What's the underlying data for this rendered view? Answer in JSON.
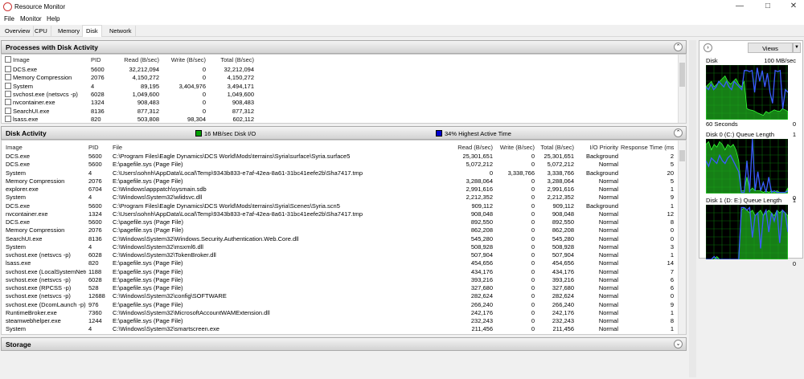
{
  "window": {
    "title": "Resource Monitor"
  },
  "menu": [
    "File",
    "Monitor",
    "Help"
  ],
  "tabs": [
    "Overview",
    "CPU",
    "Memory",
    "Disk",
    "Network"
  ],
  "active_tab": "Disk",
  "processes": {
    "title": "Processes with Disk Activity",
    "columns": [
      "Image",
      "PID",
      "Read (B/sec)",
      "Write (B/sec)",
      "Total (B/sec)"
    ],
    "rows": [
      [
        "DCS.exe",
        "5600",
        "32,212,094",
        "0",
        "32,212,094"
      ],
      [
        "Memory Compression",
        "2076",
        "4,150,272",
        "0",
        "4,150,272"
      ],
      [
        "System",
        "4",
        "89,195",
        "3,404,976",
        "3,494,171"
      ],
      [
        "svchost.exe (netsvcs -p)",
        "6028",
        "1,049,600",
        "0",
        "1,049,600"
      ],
      [
        "nvcontainer.exe",
        "1324",
        "908,483",
        "0",
        "908,483"
      ],
      [
        "SearchUI.exe",
        "8136",
        "877,312",
        "0",
        "877,312"
      ],
      [
        "lsass.exe",
        "820",
        "503,808",
        "98,304",
        "602,112"
      ]
    ]
  },
  "disk_activity": {
    "title": "Disk Activity",
    "io_label": "16 MB/sec Disk I/O",
    "active_label": "34% Highest Active Time",
    "io_color": "#00a000",
    "active_color": "#0000d0",
    "columns": [
      "Image",
      "PID",
      "File",
      "Read (B/sec)",
      "Write (B/sec)",
      "Total (B/sec)",
      "I/O Priority",
      "Response Time (ms)"
    ],
    "rows": [
      [
        "DCS.exe",
        "5600",
        "C:\\Program Files\\Eagle Dynamics\\DCS World\\Mods\\terrains\\Syria\\surface\\Syria.surface5",
        "25,301,651",
        "0",
        "25,301,651",
        "Background",
        "2"
      ],
      [
        "DCS.exe",
        "5600",
        "E:\\pagefile.sys (Page File)",
        "5,072,212",
        "0",
        "5,072,212",
        "Normal",
        "5"
      ],
      [
        "System",
        "4",
        "C:\\Users\\sohnh\\AppData\\Local\\Temp\\9343b833-e7af-42ea-8a61-31bc41eefe2b\\Sha7417.tmp",
        "0",
        "3,338,766",
        "3,338,766",
        "Background",
        "20"
      ],
      [
        "Memory Compression",
        "2076",
        "E:\\pagefile.sys (Page File)",
        "3,288,064",
        "0",
        "3,288,064",
        "Normal",
        "5"
      ],
      [
        "explorer.exe",
        "6704",
        "C:\\Windows\\apppatch\\sysmain.sdb",
        "2,991,616",
        "0",
        "2,991,616",
        "Normal",
        "1"
      ],
      [
        "System",
        "4",
        "C:\\Windows\\System32\\wlidsvc.dll",
        "2,212,352",
        "0",
        "2,212,352",
        "Normal",
        "9"
      ],
      [
        "DCS.exe",
        "5600",
        "C:\\Program Files\\Eagle Dynamics\\DCS World\\Mods\\terrains\\Syria\\Scenes\\Syria.scn5",
        "909,112",
        "0",
        "909,112",
        "Background",
        "1"
      ],
      [
        "nvcontainer.exe",
        "1324",
        "C:\\Users\\sohnh\\AppData\\Local\\Temp\\9343b833-e7af-42ea-8a61-31bc41eefe2b\\Sha7417.tmp",
        "908,048",
        "0",
        "908,048",
        "Normal",
        "12"
      ],
      [
        "DCS.exe",
        "5600",
        "C:\\pagefile.sys (Page File)",
        "892,550",
        "0",
        "892,550",
        "Normal",
        "8"
      ],
      [
        "Memory Compression",
        "2076",
        "C:\\pagefile.sys (Page File)",
        "862,208",
        "0",
        "862,208",
        "Normal",
        "0"
      ],
      [
        "SearchUI.exe",
        "8136",
        "C:\\Windows\\System32\\Windows.Security.Authentication.Web.Core.dll",
        "545,280",
        "0",
        "545,280",
        "Normal",
        "0"
      ],
      [
        "System",
        "4",
        "C:\\Windows\\System32\\msxml6.dll",
        "508,928",
        "0",
        "508,928",
        "Normal",
        "3"
      ],
      [
        "svchost.exe (netsvcs -p)",
        "6028",
        "C:\\Windows\\System32\\TokenBroker.dll",
        "507,904",
        "0",
        "507,904",
        "Normal",
        "1"
      ],
      [
        "lsass.exe",
        "820",
        "E:\\pagefile.sys (Page File)",
        "454,656",
        "0",
        "454,656",
        "Normal",
        "14"
      ],
      [
        "svchost.exe (LocalSystemNetw...",
        "1188",
        "E:\\pagefile.sys (Page File)",
        "434,176",
        "0",
        "434,176",
        "Normal",
        "7"
      ],
      [
        "svchost.exe (netsvcs -p)",
        "6028",
        "E:\\pagefile.sys (Page File)",
        "393,216",
        "0",
        "393,216",
        "Normal",
        "6"
      ],
      [
        "svchost.exe (RPCSS -p)",
        "528",
        "E:\\pagefile.sys (Page File)",
        "327,680",
        "0",
        "327,680",
        "Normal",
        "6"
      ],
      [
        "svchost.exe (netsvcs -p)",
        "12688",
        "C:\\Windows\\System32\\config\\SOFTWARE",
        "282,624",
        "0",
        "282,624",
        "Normal",
        "0"
      ],
      [
        "svchost.exe (DcomLaunch -p)",
        "976",
        "E:\\pagefile.sys (Page File)",
        "266,240",
        "0",
        "266,240",
        "Normal",
        "9"
      ],
      [
        "RuntimeBroker.exe",
        "7360",
        "C:\\Windows\\System32\\MicrosoftAccountWAMExtension.dll",
        "242,176",
        "0",
        "242,176",
        "Normal",
        "1"
      ],
      [
        "steamwebhelper.exe",
        "1244",
        "E:\\pagefile.sys (Page File)",
        "232,243",
        "0",
        "232,243",
        "Normal",
        "8"
      ],
      [
        "System",
        "4",
        "C:\\Windows\\System32\\smartscreen.exe",
        "211,456",
        "0",
        "211,456",
        "Normal",
        "1"
      ]
    ]
  },
  "storage": {
    "title": "Storage"
  },
  "side": {
    "views_label": "Views",
    "graphs": [
      {
        "title": "Disk",
        "max": "100 MB/sec",
        "min": "0",
        "footer": "60 Seconds",
        "green": [
          0.6,
          0.65,
          0.7,
          0.6,
          0.65,
          0.7,
          0.75,
          0.8,
          0.7,
          0.65,
          0.7,
          0.75,
          0.65,
          0.6,
          0.7,
          0.2,
          0.18,
          0.17,
          0.15,
          0.12,
          0.1,
          0.08,
          0.15,
          0.12,
          0.15,
          0.18,
          0.16,
          0.15,
          0.2,
          0.18,
          0.15
        ],
        "blue": [
          0.6,
          0.55,
          0.65,
          0.55,
          0.6,
          0.7,
          0.65,
          0.6,
          0.7,
          0.6,
          0.55,
          0.7,
          0.65,
          0.6,
          0.55,
          0.9,
          0.9,
          0.88,
          0.9,
          0.5,
          0.95,
          0.7,
          0.9,
          0.6,
          0.85,
          0.5,
          0.3,
          0.9,
          0.88,
          0.9,
          0.2,
          0.55,
          0.5
        ]
      },
      {
        "title": "Disk 0 (C:) Queue Length",
        "max": "1",
        "min": "0",
        "green": [
          0.9,
          0.95,
          0.8,
          0.9,
          0.85,
          0.95,
          0.9,
          0.8,
          0.9,
          0.85,
          0.9,
          0.8,
          0.6,
          0.05,
          0.05,
          0.3,
          0.05,
          0.1,
          0.05,
          0.05,
          0.05,
          0.02,
          0.05,
          0.02,
          0.05,
          0.02,
          0.05,
          0.02,
          0.02,
          0.02,
          0.1
        ],
        "blue": [
          0.6,
          0.5,
          0.65,
          0.6,
          0.55,
          0.7,
          0.6,
          0.55,
          0.65,
          0.7,
          0.6,
          0.5,
          0.4,
          0.02,
          0.02,
          0.6,
          0.02,
          1,
          0.05,
          0.4,
          0.05,
          0.2,
          0.02,
          0.3,
          0.02,
          0.05,
          0.02,
          0.02,
          0.02,
          0.02,
          0.05
        ]
      },
      {
        "title": "Disk 1 (D: E:) Queue Length",
        "max": "1",
        "min": "0",
        "green": [
          0,
          0,
          0,
          0,
          0.05,
          0,
          0,
          0,
          0,
          0,
          0,
          0,
          0,
          0.9,
          0.95,
          0.9,
          0.85,
          0.9,
          0.8,
          0.85,
          0.9,
          0.8,
          0.85,
          0.9,
          0.85,
          0.8,
          0.9,
          0.85,
          0.9,
          0.85,
          0.8
        ],
        "blue": [
          0,
          0,
          0,
          0.05,
          0,
          0,
          0,
          0,
          0,
          0,
          0,
          0,
          0,
          0.95,
          0.95,
          0.9,
          0.95,
          0.4,
          0.8,
          0.85,
          0.2,
          0.8,
          0.9,
          0.5,
          0.85,
          0.7,
          0.9,
          0.3,
          0.9,
          0.85,
          0.5
        ]
      }
    ]
  }
}
